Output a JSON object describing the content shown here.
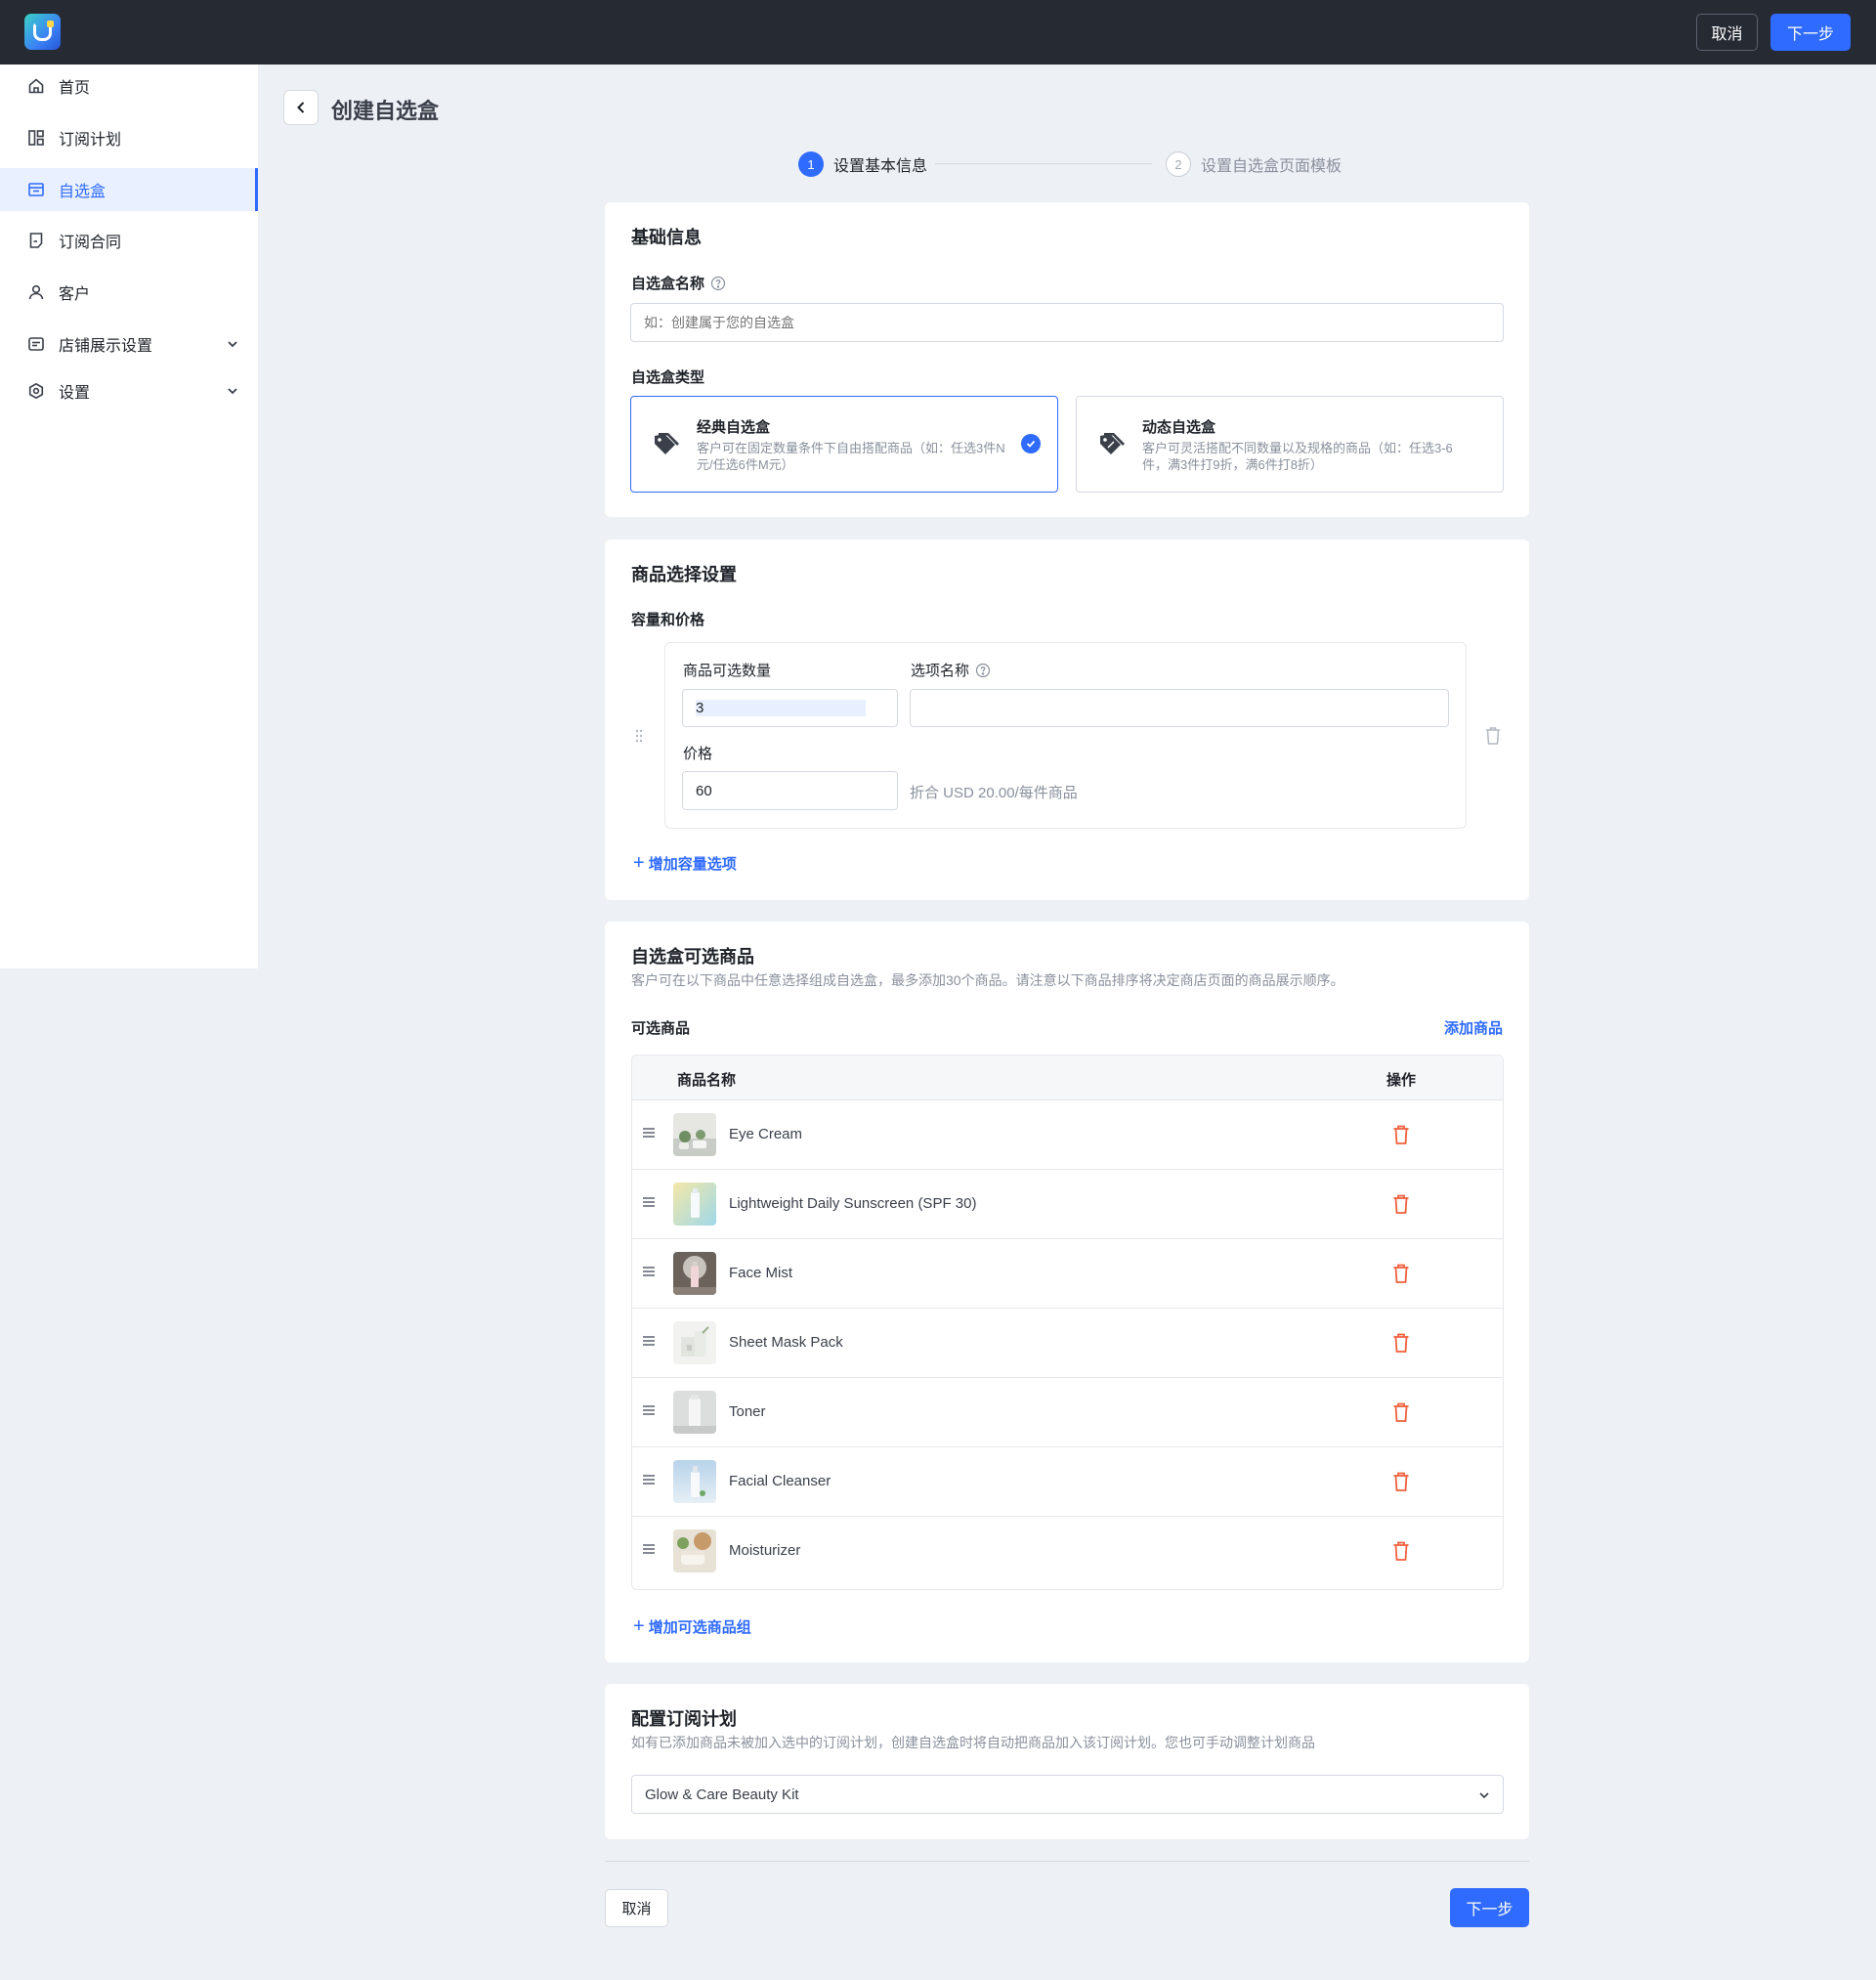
{
  "topbar": {
    "cancel_label": "取消",
    "next_label": "下一步"
  },
  "sidebar": {
    "items": [
      {
        "label": "首页",
        "icon": "home-icon"
      },
      {
        "label": "订阅计划",
        "icon": "layout-icon"
      },
      {
        "label": "自选盒",
        "icon": "box-icon",
        "active": true
      },
      {
        "label": "订阅合同",
        "icon": "contract-icon"
      },
      {
        "label": "客户",
        "icon": "user-icon"
      },
      {
        "label": "店铺展示设置",
        "icon": "display-icon",
        "expandable": true
      },
      {
        "label": "设置",
        "icon": "settings-icon",
        "expandable": true
      }
    ]
  },
  "header": {
    "title": "创建自选盒"
  },
  "steps": [
    {
      "number": "1",
      "label": "设置基本信息",
      "active": true
    },
    {
      "number": "2",
      "label": "设置自选盒页面模板",
      "active": false
    }
  ],
  "basic_info": {
    "title": "基础信息",
    "name_label": "自选盒名称",
    "name_placeholder": "如：创建属于您的自选盒",
    "type_label": "自选盒类型",
    "types": [
      {
        "title": "经典自选盒",
        "desc": "客户可在固定数量条件下自由搭配商品（如：任选3件N元/任选6件M元）",
        "selected": true
      },
      {
        "title": "动态自选盒",
        "desc": "客户可灵活搭配不同数量以及规格的商品（如：任选3-6件，满3件打9折，满6件打8折）",
        "selected": false
      }
    ]
  },
  "product_selection": {
    "title": "商品选择设置",
    "capacity_label": "容量和价格",
    "quantity_label": "商品可选数量",
    "quantity_value": "3",
    "option_name_label": "选项名称",
    "option_name_value": "",
    "price_label": "价格",
    "price_value": "60",
    "price_note": "折合 USD 20.00/每件商品",
    "add_capacity_label": "增加容量选项"
  },
  "selectable_products": {
    "title": "自选盒可选商品",
    "description": "客户可在以下商品中任意选择组成自选盒，最多添加30个商品。请注意以下商品排序将决定商店页面的商品展示顺序。",
    "list_label": "可选商品",
    "add_product_label": "添加商品",
    "columns": {
      "name": "商品名称",
      "action": "操作"
    },
    "rows": [
      {
        "name": "Eye Cream"
      },
      {
        "name": "Lightweight Daily Sunscreen (SPF 30)"
      },
      {
        "name": "Face Mist"
      },
      {
        "name": "Sheet Mask Pack"
      },
      {
        "name": "Toner"
      },
      {
        "name": "Facial Cleanser"
      },
      {
        "name": "Moisturizer"
      }
    ],
    "add_group_label": "增加可选商品组"
  },
  "subscription_plan": {
    "title": "配置订阅计划",
    "description": "如有已添加商品未被加入选中的订阅计划，创建自选盒时将自动把商品加入该订阅计划。您也可手动调整计划商品",
    "selected_plan": "Glow & Care Beauty Kit"
  },
  "footer": {
    "cancel_label": "取消",
    "next_label": "下一步"
  },
  "colors": {
    "accent": "#2f6bff",
    "topbar": "#262a33",
    "danger": "#f0603e",
    "background": "#edf0f4"
  }
}
